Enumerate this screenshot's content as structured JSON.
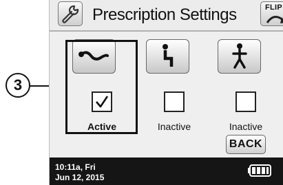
{
  "callout": {
    "number": "3"
  },
  "header": {
    "title": "Prescription Settings",
    "flip_label": "FLIP"
  },
  "modes": [
    {
      "name": "walk-mode",
      "status": "Active",
      "checked": true
    },
    {
      "name": "sit-mode",
      "status": "Inactive",
      "checked": false
    },
    {
      "name": "stand-mode",
      "status": "Inactive",
      "checked": false
    }
  ],
  "back_label": "BACK",
  "footer": {
    "time": "10:11a, Fri",
    "date": "Jun 12, 2015"
  },
  "icons": {
    "settings": "wrench-icon",
    "flip": "flip-icon",
    "mode_1": "wave-icon",
    "mode_2": "seated-person-icon",
    "mode_3": "standing-person-icon",
    "check": "checkmark-icon",
    "battery": "battery-icon"
  }
}
